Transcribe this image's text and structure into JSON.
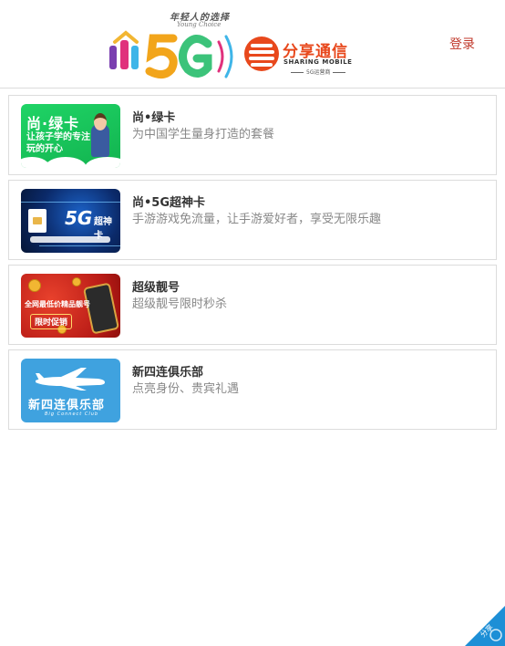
{
  "header": {
    "slogan": "年轻人的选择",
    "slogan_en": "Young Choice",
    "logo_text": "尚5G",
    "brand_name": "分享通信",
    "brand_en": "SHARING MOBILE",
    "brand_sub": "5G运营商",
    "login_label": "登录"
  },
  "colors": {
    "accent": "#c0392b",
    "brand_orange": "#e8481c",
    "share_blue": "#1d8fd6"
  },
  "products": [
    {
      "title": "尚•绿卡",
      "description": "为中国学生量身打造的套餐",
      "thumb": {
        "big": "尚·绿卡",
        "line1": "让孩子学的专注",
        "line2": "玩的开心"
      }
    },
    {
      "title": "尚•5G超神卡",
      "description": "手游游戏免流量，让手游爱好者，享受无限乐趣",
      "thumb": {
        "big": "5G",
        "cn": "超神卡"
      }
    },
    {
      "title": "超级靓号",
      "description": "超级靓号限时秒杀",
      "thumb": {
        "big": "全网最低价精品靓号",
        "tag": "限时促销"
      }
    },
    {
      "title": "新四连俱乐部",
      "description": "点亮身份、贵宾礼遇",
      "thumb": {
        "big": "新四连俱乐部",
        "en": "Big Connect Club"
      }
    }
  ],
  "share": {
    "label": "分享",
    "icon": "share-icon"
  }
}
